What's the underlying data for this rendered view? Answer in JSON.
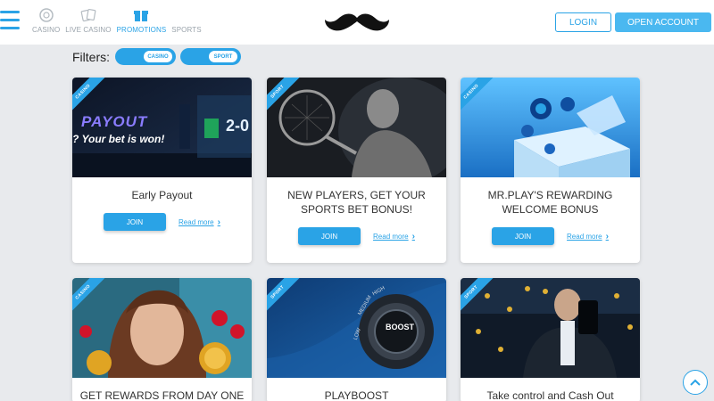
{
  "header": {
    "nav": [
      {
        "label": "CASINO",
        "icon": "casino-chip-icon",
        "active": false
      },
      {
        "label": "LIVE CASINO",
        "icon": "cards-icon",
        "active": false
      },
      {
        "label": "PROMOTIONS",
        "icon": "gift-icon",
        "active": true
      },
      {
        "label": "SPORTS",
        "icon": "sports-icon",
        "active": false
      }
    ],
    "login_label": "LOGIN",
    "open_account_label": "OPEN ACCOUNT",
    "accent": "#2aa3e6"
  },
  "filters": {
    "label": "Filters:",
    "toggles": [
      {
        "label": "CASINO",
        "on": true
      },
      {
        "label": "SPORT",
        "on": true
      }
    ]
  },
  "cards": [
    {
      "category": "CASINO",
      "title_lines": [
        "Early Payout"
      ],
      "join": "JOIN",
      "read_more": "Read more",
      "image_text": [
        "PAYOUT",
        "? Your bet is won!",
        "2-0"
      ]
    },
    {
      "category": "SPORT",
      "title_lines": [
        "NEW PLAYERS, GET YOUR",
        "SPORTS BET BONUS!"
      ],
      "join": "JOIN",
      "read_more": "Read more"
    },
    {
      "category": "CASINO",
      "title_lines": [
        "MR.PLAY'S REWARDING",
        "WELCOME BONUS"
      ],
      "join": "JOIN",
      "read_more": "Read more"
    },
    {
      "category": "CASINO",
      "title_lines": [
        "GET REWARDS FROM DAY ONE"
      ]
    },
    {
      "category": "SPORT",
      "title_lines": [
        "PLAYBOOST"
      ],
      "image_text": [
        "BOOST",
        "LOW",
        "MEDIUM",
        "HIGH"
      ]
    },
    {
      "category": "SPORT",
      "title_lines": [
        "Take control and Cash Out"
      ]
    }
  ]
}
